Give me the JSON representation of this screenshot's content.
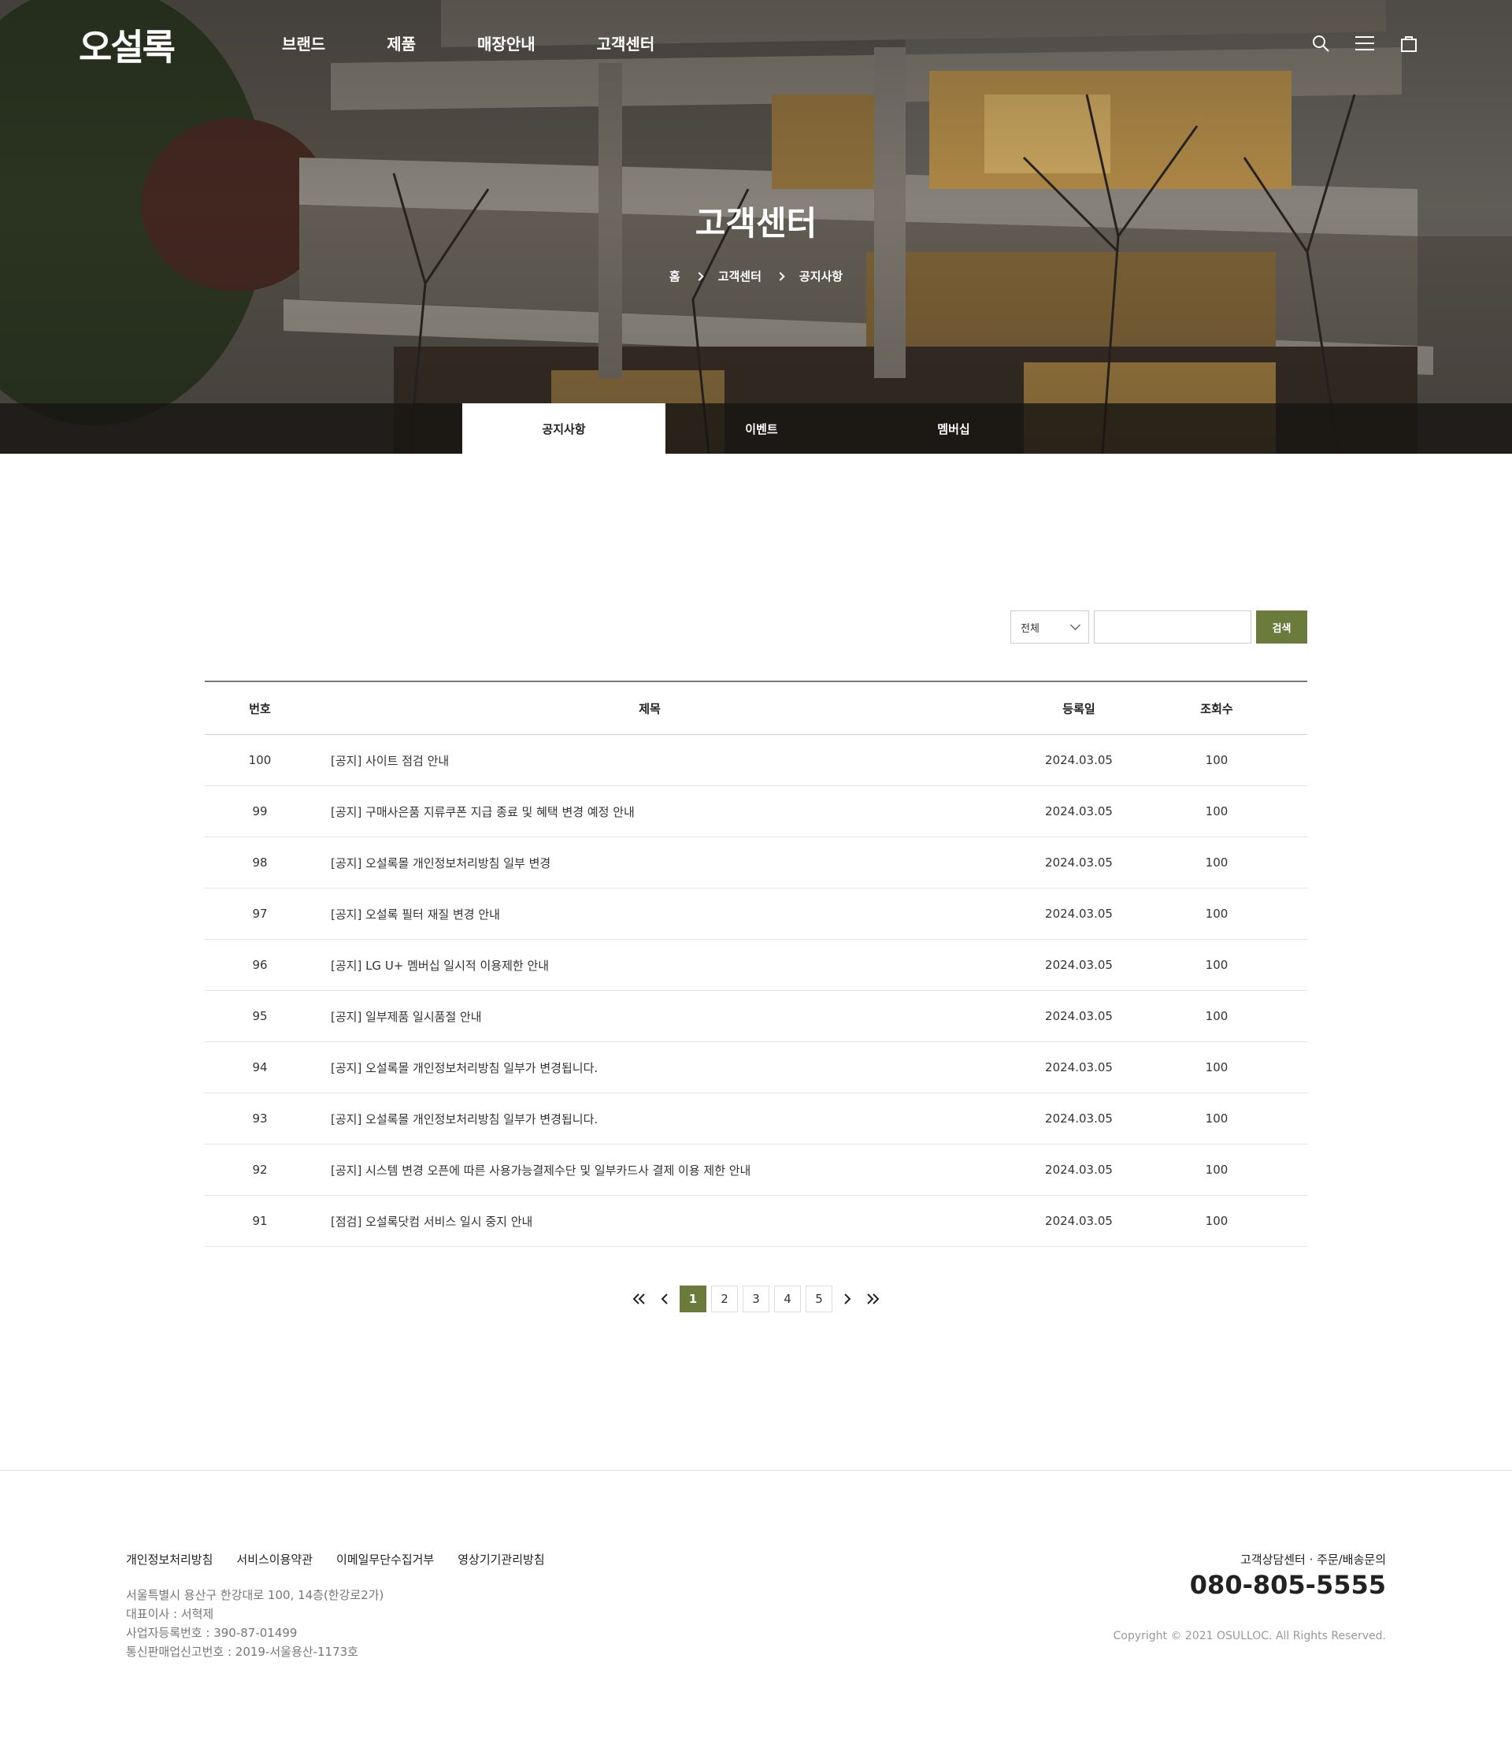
{
  "header": {
    "logo": "오설록",
    "menu": [
      "브랜드",
      "제품",
      "매장안내",
      "고객센터"
    ]
  },
  "hero": {
    "title": "고객센터",
    "breadcrumb": [
      "홈",
      "고객센터",
      "공지사항"
    ]
  },
  "tabs": [
    "공지사항",
    "이벤트",
    "멤버십"
  ],
  "active_tab": "공지사항",
  "search": {
    "select_value": "전체",
    "input_value": "",
    "button_label": "검색"
  },
  "board": {
    "columns": [
      "번호",
      "제목",
      "등록일",
      "조회수"
    ],
    "rows": [
      {
        "no": "100",
        "title": "[공지] 사이트 점검 안내",
        "date": "2024.03.05",
        "views": "100"
      },
      {
        "no": "99",
        "title": "[공지] 구매사은품 지류쿠폰 지급 종료 및 혜택 변경 예정 안내",
        "date": "2024.03.05",
        "views": "100"
      },
      {
        "no": "98",
        "title": "[공지] 오설록몰 개인정보처리방침 일부 변경",
        "date": "2024.03.05",
        "views": "100"
      },
      {
        "no": "97",
        "title": "[공지] 오설록 필터 재질 변경 안내",
        "date": "2024.03.05",
        "views": "100"
      },
      {
        "no": "96",
        "title": "[공지] LG U+ 멤버십 일시적 이용제한 안내",
        "date": "2024.03.05",
        "views": "100"
      },
      {
        "no": "95",
        "title": "[공지] 일부제품 일시품절 안내",
        "date": "2024.03.05",
        "views": "100"
      },
      {
        "no": "94",
        "title": "[공지] 오설록몰 개인정보처리방침 일부가 변경됩니다.",
        "date": "2024.03.05",
        "views": "100"
      },
      {
        "no": "93",
        "title": "[공지] 오설록몰 개인정보처리방침 일부가 변경됩니다.",
        "date": "2024.03.05",
        "views": "100"
      },
      {
        "no": "92",
        "title": "[공지] 시스템 변경 오픈에 따른 사용가능결제수단 및 일부카드사 결제 이용 제한 안내",
        "date": "2024.03.05",
        "views": "100"
      },
      {
        "no": "91",
        "title": "[점검] 오설록닷컴 서비스 일시 중지 안내",
        "date": "2024.03.05",
        "views": "100"
      }
    ]
  },
  "pagination": {
    "pages": [
      "1",
      "2",
      "3",
      "4",
      "5"
    ],
    "current": "1"
  },
  "footer": {
    "links": [
      "개인정보처리방침",
      "서비스이용약관",
      "이메일무단수집거부",
      "영상기기관리방침"
    ],
    "address": "서울특별시 용산구 한강대로 100, 14층(한강로2가)",
    "ceo": "대표이사 : 서혁제",
    "biz_no": "사업자등록번호 : 390-87-01499",
    "mail_order_no": "통신판매업신고번호 : 2019-서울용산-1173호",
    "cs_label": "고객상담센터 · 주문/배송문의",
    "phone": "080-805-5555",
    "copyright": "Copyright © 2021 OSULLOC. All Rights Reserved."
  },
  "colors": {
    "accent": "#6b7b3c",
    "tabbar_bg": "#1e1a17"
  }
}
